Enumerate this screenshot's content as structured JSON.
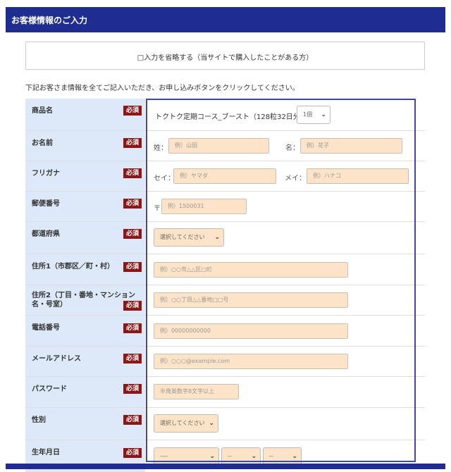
{
  "header": {
    "title": "お客様情報のご入力"
  },
  "skip": {
    "label": "□入力を省略する（当サイトで購入したことがある方）"
  },
  "intro": "下記お客さま情報を全てご記入いただき、お申し込みボタンをクリックしてください。",
  "required_label": "必須",
  "fields": {
    "product": {
      "label": "商品名",
      "value": "トクトク定期コース_ブースト（128粒32日分）",
      "qty": "1個"
    },
    "name": {
      "label": "お名前",
      "sei_prefix": "姓：",
      "sei_placeholder": "例）山田",
      "mei_prefix": "名：",
      "mei_placeholder": "例）花子"
    },
    "kana": {
      "label": "フリガナ",
      "sei_prefix": "セイ：",
      "sei_placeholder": "例）ヤマダ",
      "mei_prefix": "メイ：",
      "mei_placeholder": "例）ハナコ"
    },
    "zip": {
      "label": "郵便番号",
      "prefix": "〒",
      "placeholder": "例）1500031"
    },
    "pref": {
      "label": "都道府県",
      "value": "選択してください"
    },
    "addr1": {
      "label": "住所1（市郡区／町・村）",
      "placeholder": "例）○○市△△区□町"
    },
    "addr2": {
      "label": "住所2（丁目・番地・マンション名・号室）",
      "placeholder": "例）○○丁目△△番地□□号"
    },
    "tel": {
      "label": "電話番号",
      "placeholder": "例）00000000000"
    },
    "email": {
      "label": "メールアドレス",
      "placeholder": "例）○○○@example.com"
    },
    "password": {
      "label": "パスワード",
      "placeholder": "半角英数字8文字以上"
    },
    "sex": {
      "label": "性別",
      "value": "選択してください"
    },
    "birth": {
      "label": "生年月日",
      "year": "----",
      "month": "--",
      "day": "--"
    }
  }
}
